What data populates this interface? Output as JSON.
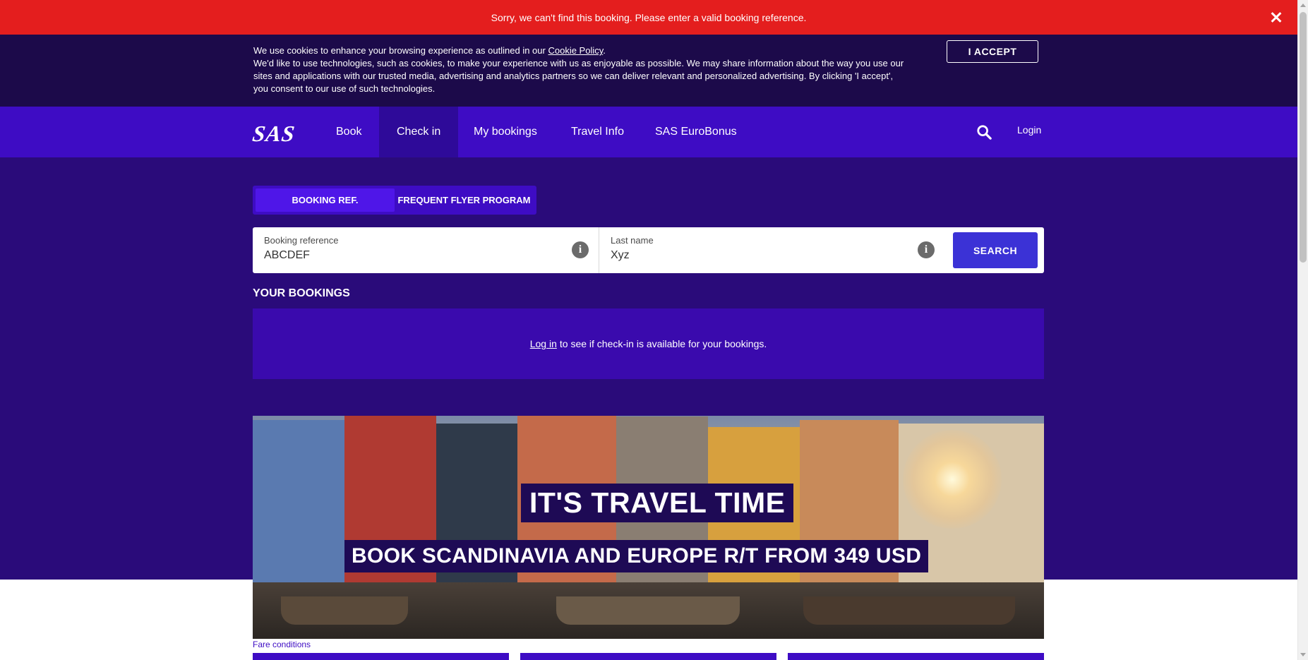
{
  "error_banner": {
    "message": "Sorry, we can't find this booking. Please enter a valid booking reference.",
    "close_icon": "close-icon"
  },
  "cookie": {
    "line1_prefix": "We use cookies to enhance your browsing experience as outlined in our ",
    "policy_link": "Cookie Policy",
    "line1_suffix": ".",
    "line2": "We'd like to use technologies, such as cookies, to make your experience with us as enjoyable as possible. We may share information about the way you use our sites and applications with our trusted media, advertising and analytics partners so we can deliver relevant and personalized advertising. By clicking 'I accept', you consent to our use of such technologies.",
    "accept_label": "I ACCEPT"
  },
  "nav": {
    "logo": "SAS",
    "items": [
      {
        "label": "Book"
      },
      {
        "label": "Check in"
      },
      {
        "label": "My bookings"
      },
      {
        "label": "Travel Info"
      },
      {
        "label": "SAS EuroBonus"
      }
    ],
    "search_icon": "search-icon",
    "login": "Login"
  },
  "tabs": {
    "booking_ref": "BOOKING REF.",
    "frequent_flyer": "FREQUENT FLYER PROGRAM"
  },
  "search": {
    "booking_label": "Booking reference",
    "booking_value": "ABCDEF",
    "lastname_label": "Last name",
    "lastname_value": "Xyz",
    "info_icon": "info-icon",
    "button": "SEARCH"
  },
  "bookings": {
    "title": "YOUR BOOKINGS",
    "login_link": "Log in",
    "message": "to see if check-in is available for your bookings."
  },
  "promo": {
    "title": "IT'S TRAVEL TIME",
    "subtitle": "BOOK SCANDINAVIA AND EUROPE R/T FROM 349 USD"
  },
  "fare_conditions": "Fare conditions",
  "colors": {
    "error": "#e41e1e",
    "cookie_bg": "#1c0a4a",
    "nav_bg": "#3e0cc4",
    "hero_bg": "#2a0b7a",
    "search_button": "#3b32d6"
  }
}
